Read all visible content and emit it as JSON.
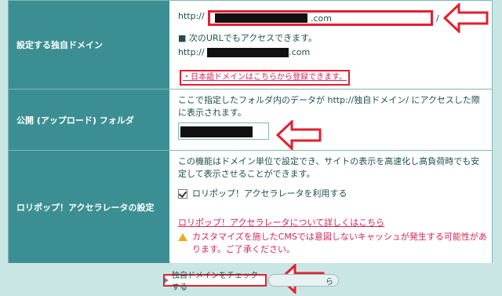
{
  "labels": {
    "domain": "設定する独自ドメイン",
    "folder": "公開 (アップロード) フォルダ",
    "accelerator": "ロリポップ！アクセラレータの設定"
  },
  "domain": {
    "prefix": "http://",
    "suffix": ".com",
    "trailing_slash": "/",
    "note": "■ 次のURLでもアクセスできます。",
    "alt_prefix": "http://",
    "alt_suffix": ".com",
    "jp_domain_link": "・日本語ドメインはこちらから登録できます。"
  },
  "folder": {
    "description": "ここで指定したフォルダ内のデータが http://独自ドメイン/ にアクセスした際に表示されます。"
  },
  "accelerator": {
    "description": "この機能はドメイン単位で設定でき、サイトの表示を高速化し高負荷時でも安定して表示させることができます。",
    "checkbox_label": "ロリポップ！アクセラレータを利用する",
    "checkbox_checked": true,
    "detail_link": "ロリポップ！アクセラレータについて詳しくはこちら",
    "warning": "カスタマイズを施したCMSでは意図しないキャッシュが発生する可能性があります。ご了承ください。"
  },
  "buttons": {
    "check_domain": "独自ドメインをチェックする",
    "secondary": "ら"
  },
  "colors": {
    "accent": "#3b8f93",
    "highlight_red": "#e41f2f",
    "link_pink": "#d9245a",
    "background": "#c9e6e4"
  }
}
